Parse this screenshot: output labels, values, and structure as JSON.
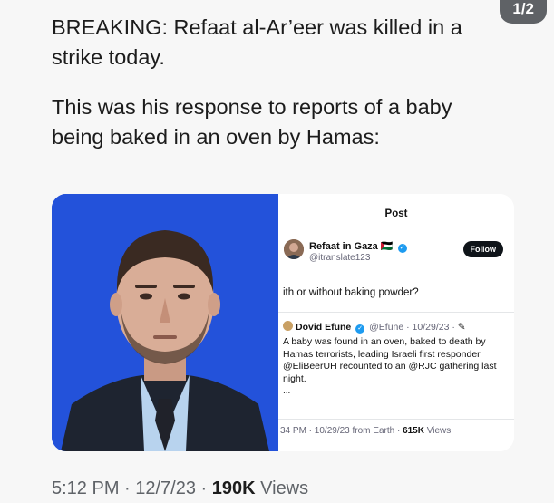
{
  "image_counter": "1/2",
  "tweet": {
    "text_line1": "BREAKING: Refaat al-Ar’eer was killed in a strike today.",
    "text_line2": "This was his response to reports of a baby being baked in an oven by Hamas:"
  },
  "quoted_post": {
    "header": "Post",
    "author_name": "Refaat in Gaza",
    "author_name_flag": "🇵🇸",
    "author_handle": "@itranslate123",
    "follow_label": "Follow",
    "reply_text": "ith or without baking powder?",
    "replied": {
      "name": "Dovid Efune",
      "handle_meta": "@Efune · 10/29/23 ·",
      "body": "A baby was found in an oven, baked to death by Hamas terrorists, leading Israeli first responder @EliBeerUH recounted to an @RJC gathering last night.",
      "ellipsis": "..."
    },
    "footer_time": "34 PM · 10/29/23 from Earth ·",
    "footer_views_count": "615K",
    "footer_views_label": "Views"
  },
  "meta": {
    "time": "5:12 PM · 12/7/23 ·",
    "views_count": "190K",
    "views_label": "Views"
  },
  "colors": {
    "photo_background": "#1f4fd6",
    "verified_badge": "#1d9bf0",
    "follow_button": "#0f1419"
  }
}
